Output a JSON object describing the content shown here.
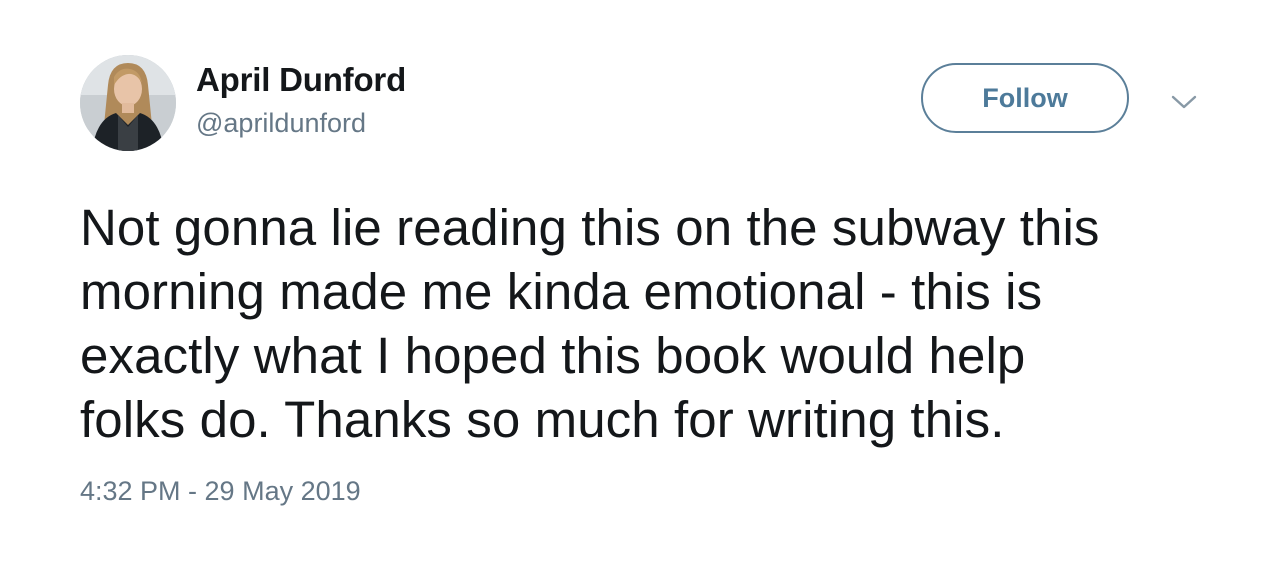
{
  "user": {
    "display_name": "April Dunford",
    "handle": "@aprildunford",
    "avatar_icon": "profile-photo"
  },
  "actions": {
    "follow_label": "Follow",
    "menu_icon": "chevron-down-icon"
  },
  "tweet": {
    "lines": [
      "Not gonna lie reading this on the subway this",
      "morning made me kinda emotional - this is",
      "exactly what I hoped this book would help",
      "folks do. Thanks so much for writing this."
    ],
    "timestamp": "4:32 PM - 29 May 2019"
  },
  "colors": {
    "text": "#14171a",
    "secondary": "#657786",
    "follow_border": "#5b7f99",
    "follow_text": "#4d7a9a",
    "background": "#ffffff"
  }
}
